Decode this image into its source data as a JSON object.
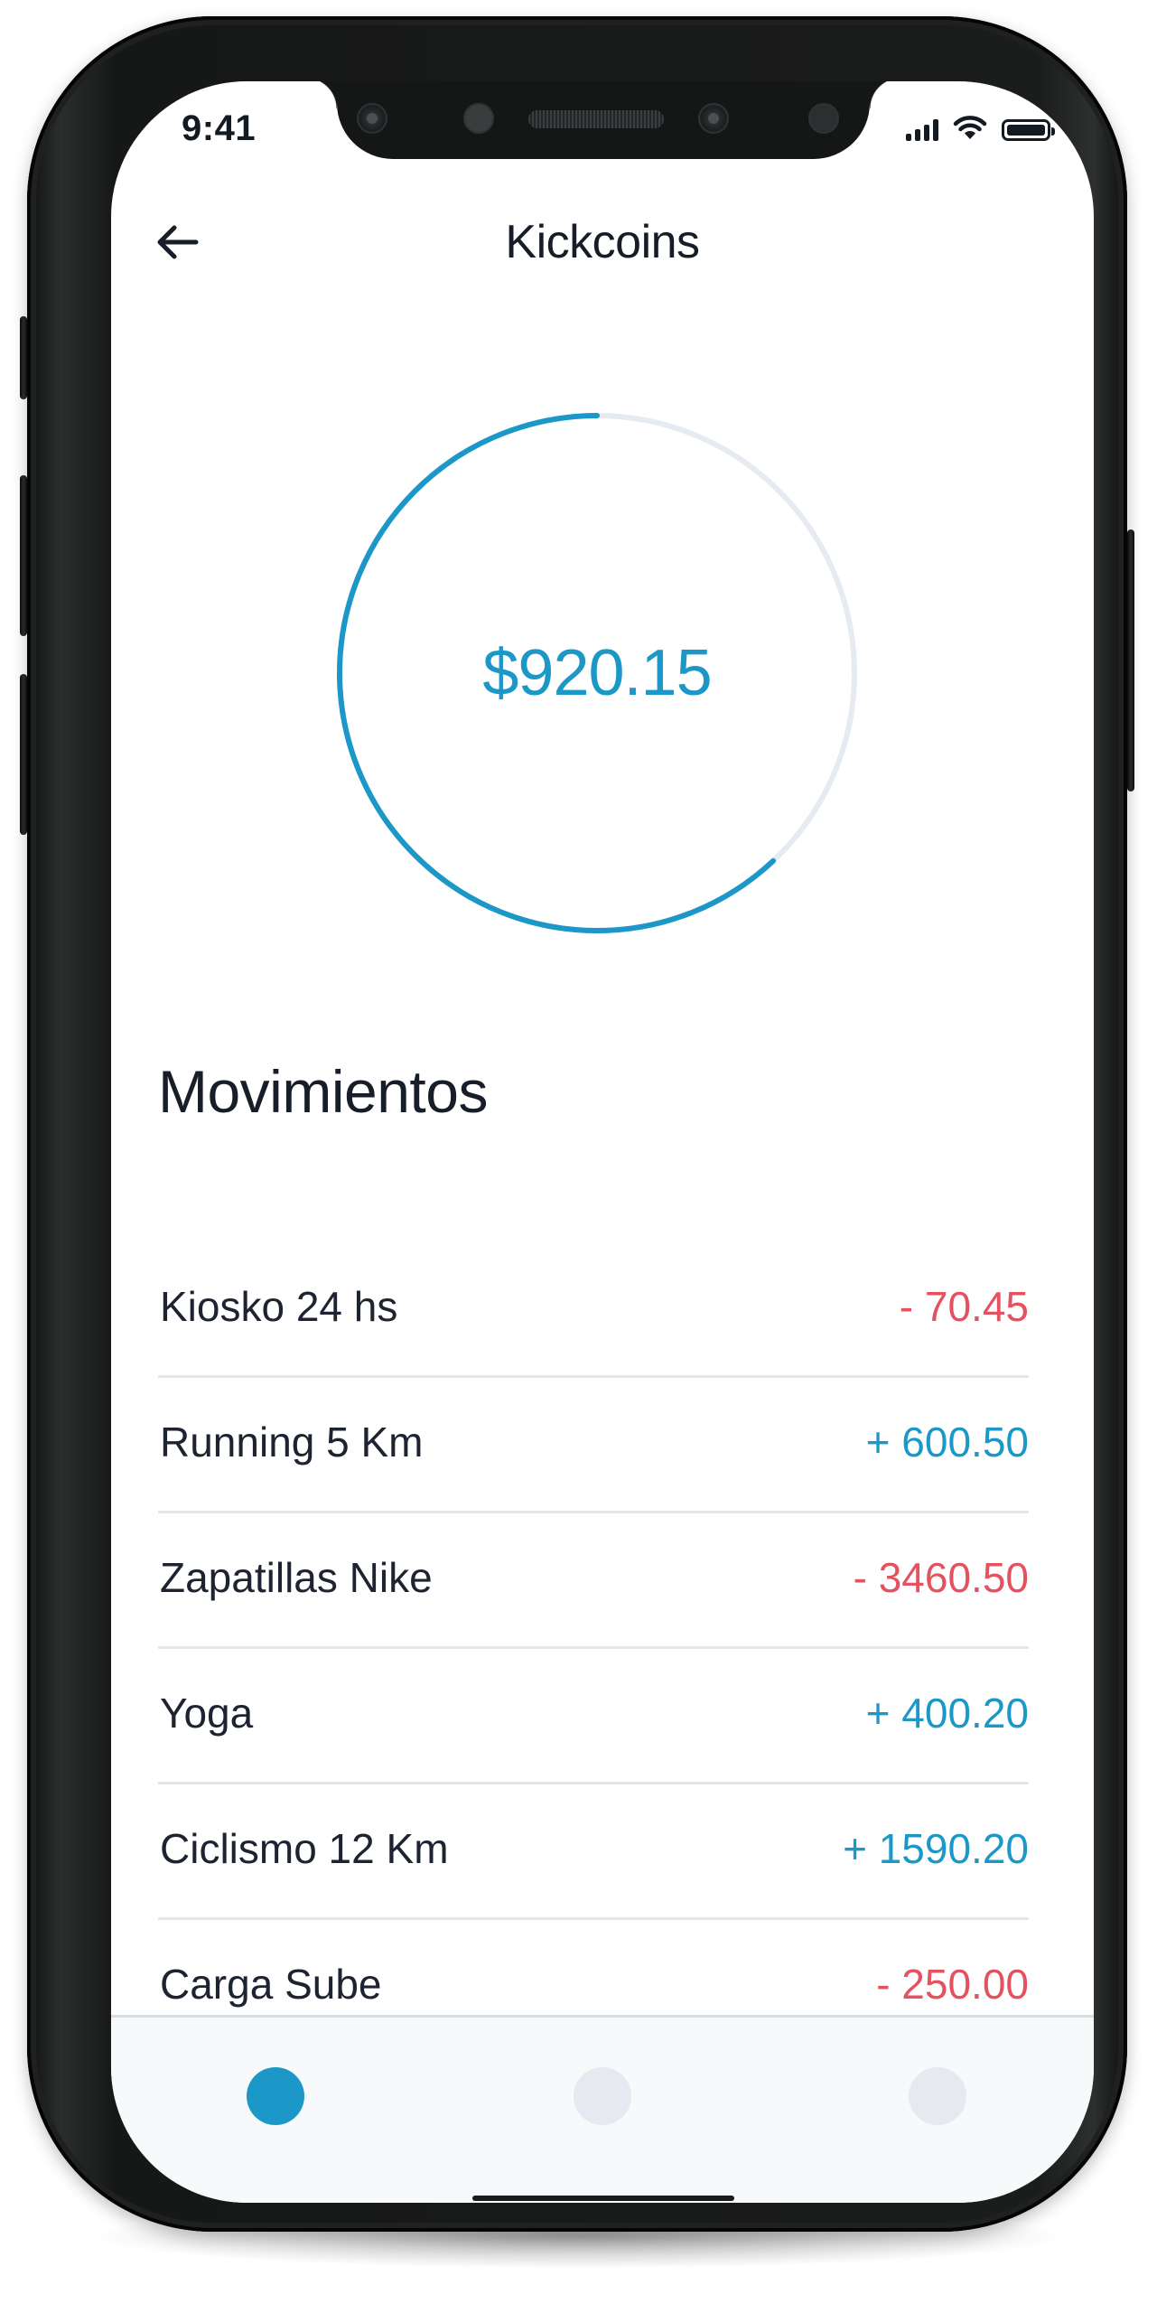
{
  "status_bar": {
    "time": "9:41",
    "icons": [
      "signal-icon",
      "wifi-icon",
      "battery-icon"
    ]
  },
  "nav": {
    "back_icon": "arrow-left-icon",
    "title": "Kickcoins"
  },
  "balance": {
    "amount": "$920.15",
    "progress": 0.62,
    "colors": {
      "progress": "#1b98c7",
      "track": "#e6ebf1"
    }
  },
  "movements": {
    "title": "Movimientos",
    "items": [
      {
        "name": "Kiosko 24 hs",
        "amount": "- 70.45",
        "type": "debit"
      },
      {
        "name": "Running 5 Km",
        "amount": "+ 600.50",
        "type": "credit"
      },
      {
        "name": "Zapatillas Nike",
        "amount": "- 3460.50",
        "type": "debit"
      },
      {
        "name": "Yoga",
        "amount": "+ 400.20",
        "type": "credit"
      },
      {
        "name": "Ciclismo 12 Km",
        "amount": "+ 1590.20",
        "type": "credit"
      },
      {
        "name": "Carga Sube",
        "amount": "- 250.00",
        "type": "debit"
      }
    ],
    "colors": {
      "credit": "#1b98c7",
      "debit": "#e5525f"
    }
  },
  "tab_bar": {
    "tabs": [
      {
        "name": "tab-1",
        "active": true
      },
      {
        "name": "tab-2",
        "active": false
      },
      {
        "name": "tab-3",
        "active": false
      }
    ],
    "colors": {
      "active": "#1b98c7",
      "inactive": "#e6e9ef"
    }
  }
}
